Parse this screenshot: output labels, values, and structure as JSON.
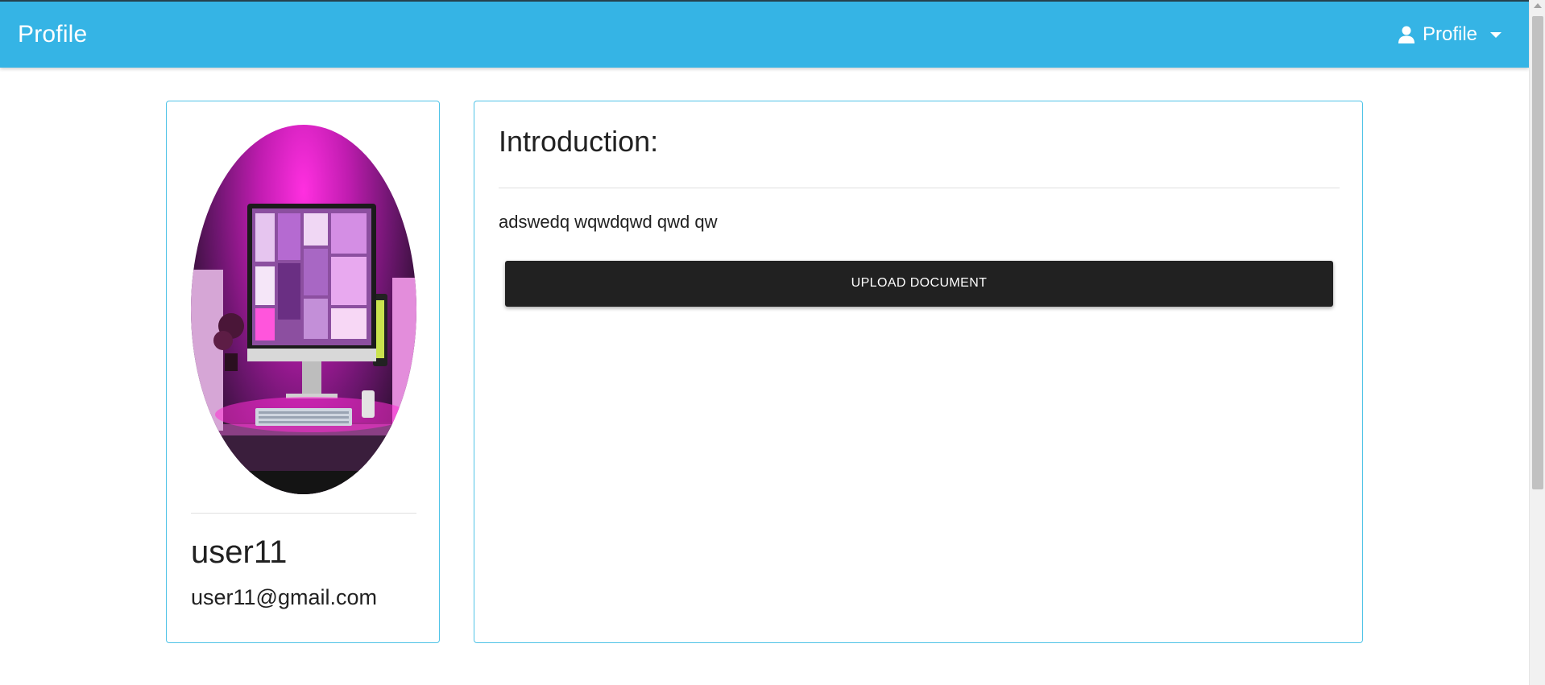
{
  "header": {
    "brand_title": "Profile",
    "profile_menu_label": "Profile",
    "background_color": "#35b4e5",
    "icons": {
      "user": "user-icon",
      "dropdown": "caret-down-icon"
    }
  },
  "profile_card": {
    "avatar_alt": "profile-photo",
    "username": "user11",
    "email": "user11@gmail.com",
    "border_color": "#4fc3e7"
  },
  "intro_card": {
    "title": "Introduction:",
    "text": "adswedq wqwdqwd qwd qw",
    "upload_button_label": "UPLOAD DOCUMENT",
    "button_color": "#212121"
  }
}
